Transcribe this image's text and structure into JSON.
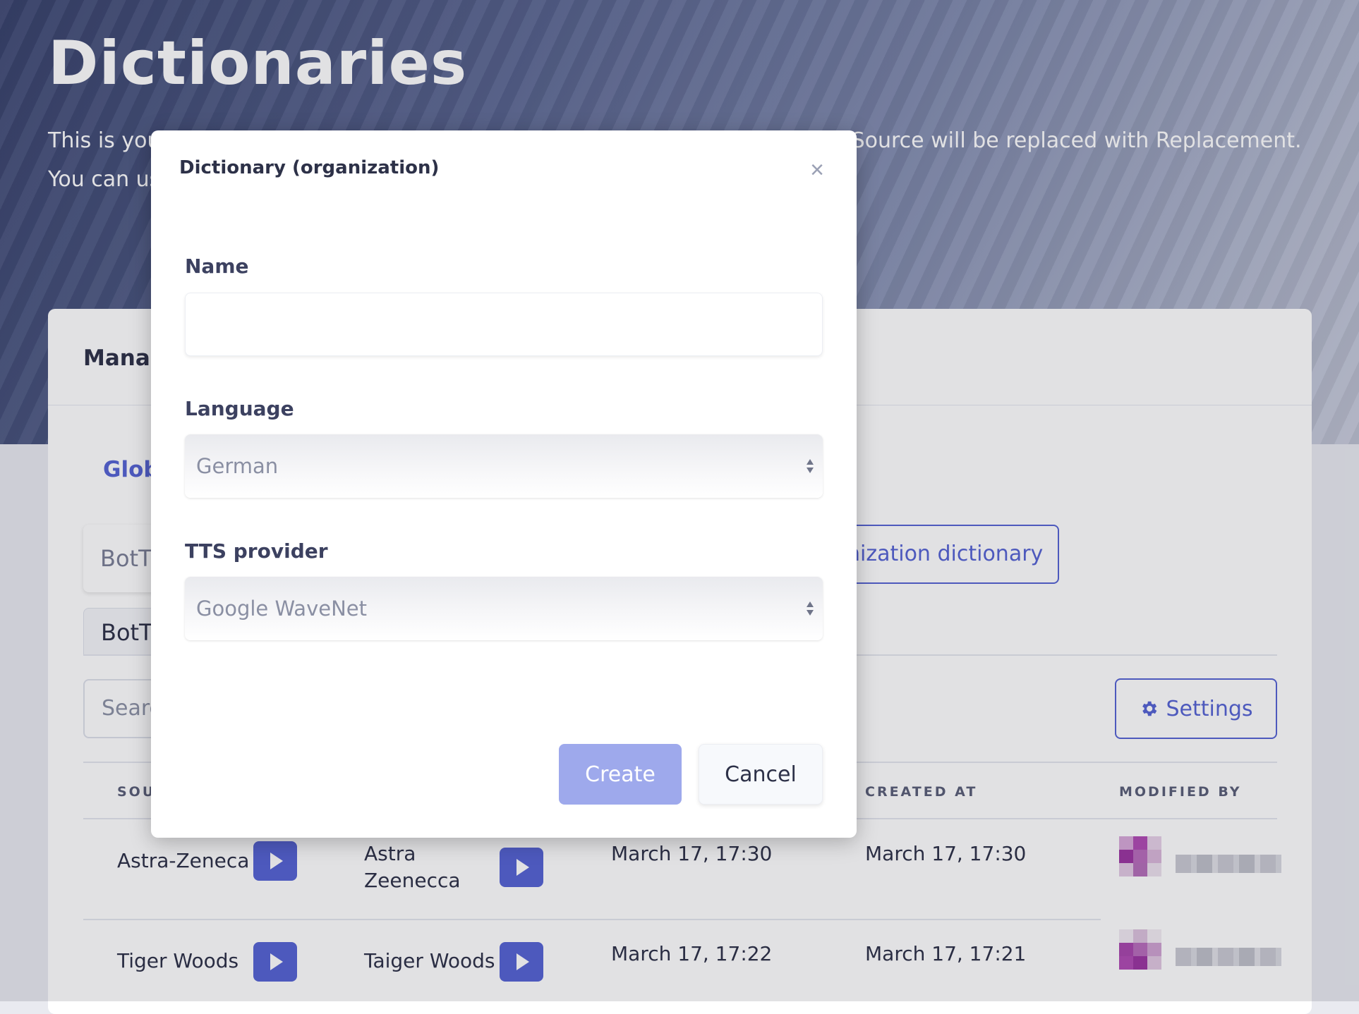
{
  "page": {
    "title": "Dictionaries",
    "description_line1": "This is you",
    "description_line1_tail": "Source will be replaced with Replacement.",
    "description_line2": "You can us"
  },
  "card": {
    "title": "Manag",
    "tab_global": "Glob",
    "bot_select_value": "BotT",
    "add_org_dictionary_label": "nization dictionary",
    "bot_tab_label": "BotT",
    "search_placeholder": "Searc",
    "settings_label": "Settings"
  },
  "table": {
    "columns": [
      "SOU",
      "CREATED AT",
      "MODIFIED BY"
    ],
    "rows": [
      {
        "source": "Astra-Zeneca",
        "replacement_line1": "Astra",
        "replacement_line2": "Zeenecca",
        "modified_at": "March 17, 17:30",
        "created_at": "March 17, 17:30"
      },
      {
        "source": "Tiger Woods",
        "replacement_line1": "Taiger Woods",
        "replacement_line2": "",
        "modified_at": "March 17, 17:22",
        "created_at": "March 17, 17:21"
      }
    ]
  },
  "modal": {
    "title": "Dictionary (organization)",
    "close_glyph": "×",
    "name_label": "Name",
    "name_value": "",
    "language_label": "Language",
    "language_value": "German",
    "tts_label": "TTS provider",
    "tts_value": "Google WaveNet",
    "create_label": "Create",
    "cancel_label": "Cancel"
  },
  "colors": {
    "accent": "#5563d4",
    "create_button": "#9ea9ec",
    "hero_overlay": "#4a5580"
  },
  "icons": [
    "close-icon",
    "gear-icon",
    "play-icon",
    "select-arrows-icon"
  ]
}
